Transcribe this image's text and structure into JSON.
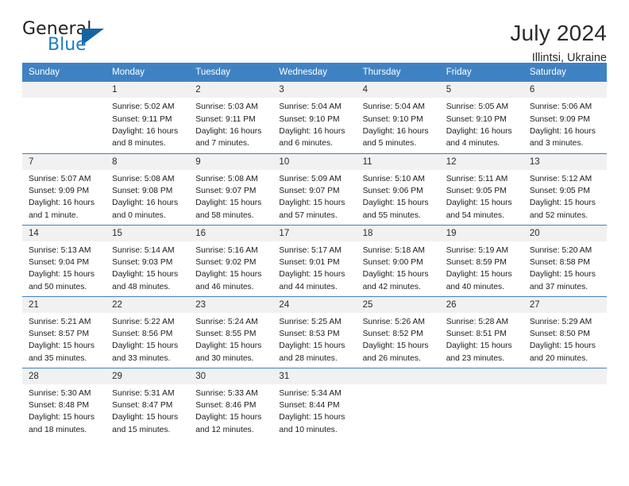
{
  "brand": {
    "word_general": "General",
    "word_blue": "Blue"
  },
  "header": {
    "title": "July 2024",
    "location": "Illintsi, Ukraine"
  },
  "calendar": {
    "weekdays": [
      "Sunday",
      "Monday",
      "Tuesday",
      "Wednesday",
      "Thursday",
      "Friday",
      "Saturday"
    ],
    "accent_color": "#3f82c4",
    "daynum_background": "#f1f1f1",
    "weeks": [
      [
        {
          "day": "",
          "lines": []
        },
        {
          "day": "1",
          "lines": [
            "Sunrise: 5:02 AM",
            "Sunset: 9:11 PM",
            "Daylight: 16 hours",
            "and 8 minutes."
          ]
        },
        {
          "day": "2",
          "lines": [
            "Sunrise: 5:03 AM",
            "Sunset: 9:11 PM",
            "Daylight: 16 hours",
            "and 7 minutes."
          ]
        },
        {
          "day": "3",
          "lines": [
            "Sunrise: 5:04 AM",
            "Sunset: 9:10 PM",
            "Daylight: 16 hours",
            "and 6 minutes."
          ]
        },
        {
          "day": "4",
          "lines": [
            "Sunrise: 5:04 AM",
            "Sunset: 9:10 PM",
            "Daylight: 16 hours",
            "and 5 minutes."
          ]
        },
        {
          "day": "5",
          "lines": [
            "Sunrise: 5:05 AM",
            "Sunset: 9:10 PM",
            "Daylight: 16 hours",
            "and 4 minutes."
          ]
        },
        {
          "day": "6",
          "lines": [
            "Sunrise: 5:06 AM",
            "Sunset: 9:09 PM",
            "Daylight: 16 hours",
            "and 3 minutes."
          ]
        }
      ],
      [
        {
          "day": "7",
          "lines": [
            "Sunrise: 5:07 AM",
            "Sunset: 9:09 PM",
            "Daylight: 16 hours",
            "and 1 minute."
          ]
        },
        {
          "day": "8",
          "lines": [
            "Sunrise: 5:08 AM",
            "Sunset: 9:08 PM",
            "Daylight: 16 hours",
            "and 0 minutes."
          ]
        },
        {
          "day": "9",
          "lines": [
            "Sunrise: 5:08 AM",
            "Sunset: 9:07 PM",
            "Daylight: 15 hours",
            "and 58 minutes."
          ]
        },
        {
          "day": "10",
          "lines": [
            "Sunrise: 5:09 AM",
            "Sunset: 9:07 PM",
            "Daylight: 15 hours",
            "and 57 minutes."
          ]
        },
        {
          "day": "11",
          "lines": [
            "Sunrise: 5:10 AM",
            "Sunset: 9:06 PM",
            "Daylight: 15 hours",
            "and 55 minutes."
          ]
        },
        {
          "day": "12",
          "lines": [
            "Sunrise: 5:11 AM",
            "Sunset: 9:05 PM",
            "Daylight: 15 hours",
            "and 54 minutes."
          ]
        },
        {
          "day": "13",
          "lines": [
            "Sunrise: 5:12 AM",
            "Sunset: 9:05 PM",
            "Daylight: 15 hours",
            "and 52 minutes."
          ]
        }
      ],
      [
        {
          "day": "14",
          "lines": [
            "Sunrise: 5:13 AM",
            "Sunset: 9:04 PM",
            "Daylight: 15 hours",
            "and 50 minutes."
          ]
        },
        {
          "day": "15",
          "lines": [
            "Sunrise: 5:14 AM",
            "Sunset: 9:03 PM",
            "Daylight: 15 hours",
            "and 48 minutes."
          ]
        },
        {
          "day": "16",
          "lines": [
            "Sunrise: 5:16 AM",
            "Sunset: 9:02 PM",
            "Daylight: 15 hours",
            "and 46 minutes."
          ]
        },
        {
          "day": "17",
          "lines": [
            "Sunrise: 5:17 AM",
            "Sunset: 9:01 PM",
            "Daylight: 15 hours",
            "and 44 minutes."
          ]
        },
        {
          "day": "18",
          "lines": [
            "Sunrise: 5:18 AM",
            "Sunset: 9:00 PM",
            "Daylight: 15 hours",
            "and 42 minutes."
          ]
        },
        {
          "day": "19",
          "lines": [
            "Sunrise: 5:19 AM",
            "Sunset: 8:59 PM",
            "Daylight: 15 hours",
            "and 40 minutes."
          ]
        },
        {
          "day": "20",
          "lines": [
            "Sunrise: 5:20 AM",
            "Sunset: 8:58 PM",
            "Daylight: 15 hours",
            "and 37 minutes."
          ]
        }
      ],
      [
        {
          "day": "21",
          "lines": [
            "Sunrise: 5:21 AM",
            "Sunset: 8:57 PM",
            "Daylight: 15 hours",
            "and 35 minutes."
          ]
        },
        {
          "day": "22",
          "lines": [
            "Sunrise: 5:22 AM",
            "Sunset: 8:56 PM",
            "Daylight: 15 hours",
            "and 33 minutes."
          ]
        },
        {
          "day": "23",
          "lines": [
            "Sunrise: 5:24 AM",
            "Sunset: 8:55 PM",
            "Daylight: 15 hours",
            "and 30 minutes."
          ]
        },
        {
          "day": "24",
          "lines": [
            "Sunrise: 5:25 AM",
            "Sunset: 8:53 PM",
            "Daylight: 15 hours",
            "and 28 minutes."
          ]
        },
        {
          "day": "25",
          "lines": [
            "Sunrise: 5:26 AM",
            "Sunset: 8:52 PM",
            "Daylight: 15 hours",
            "and 26 minutes."
          ]
        },
        {
          "day": "26",
          "lines": [
            "Sunrise: 5:28 AM",
            "Sunset: 8:51 PM",
            "Daylight: 15 hours",
            "and 23 minutes."
          ]
        },
        {
          "day": "27",
          "lines": [
            "Sunrise: 5:29 AM",
            "Sunset: 8:50 PM",
            "Daylight: 15 hours",
            "and 20 minutes."
          ]
        }
      ],
      [
        {
          "day": "28",
          "lines": [
            "Sunrise: 5:30 AM",
            "Sunset: 8:48 PM",
            "Daylight: 15 hours",
            "and 18 minutes."
          ]
        },
        {
          "day": "29",
          "lines": [
            "Sunrise: 5:31 AM",
            "Sunset: 8:47 PM",
            "Daylight: 15 hours",
            "and 15 minutes."
          ]
        },
        {
          "day": "30",
          "lines": [
            "Sunrise: 5:33 AM",
            "Sunset: 8:46 PM",
            "Daylight: 15 hours",
            "and 12 minutes."
          ]
        },
        {
          "day": "31",
          "lines": [
            "Sunrise: 5:34 AM",
            "Sunset: 8:44 PM",
            "Daylight: 15 hours",
            "and 10 minutes."
          ]
        },
        {
          "day": "",
          "lines": []
        },
        {
          "day": "",
          "lines": []
        },
        {
          "day": "",
          "lines": []
        }
      ]
    ]
  }
}
